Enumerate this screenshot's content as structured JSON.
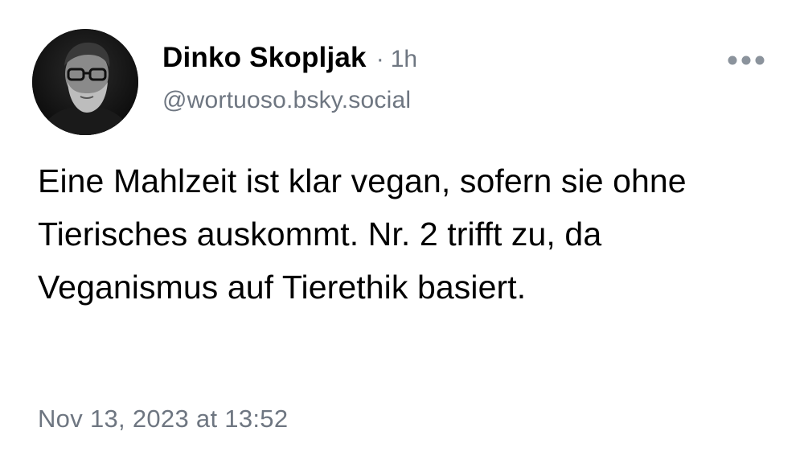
{
  "post": {
    "author": {
      "display_name": "Dinko Skopljak",
      "separator": "·",
      "time_ago": "1h",
      "handle": "@wortuoso.bsky.social",
      "avatar_icon": "person-photo-avatar"
    },
    "menu_icon": "more-horizontal-icon",
    "text": "Eine Mahlzeit ist klar vegan, sofern sie ohne Tierisches auskommt. Nr. 2 trifft zu, da Veganismus auf Tierethik basiert.",
    "timestamp": "Nov 13, 2023 at 13:52"
  },
  "colors": {
    "text": "#000000",
    "secondary": "#6e7681",
    "menu_dots": "#8b939c",
    "background": "#ffffff"
  }
}
